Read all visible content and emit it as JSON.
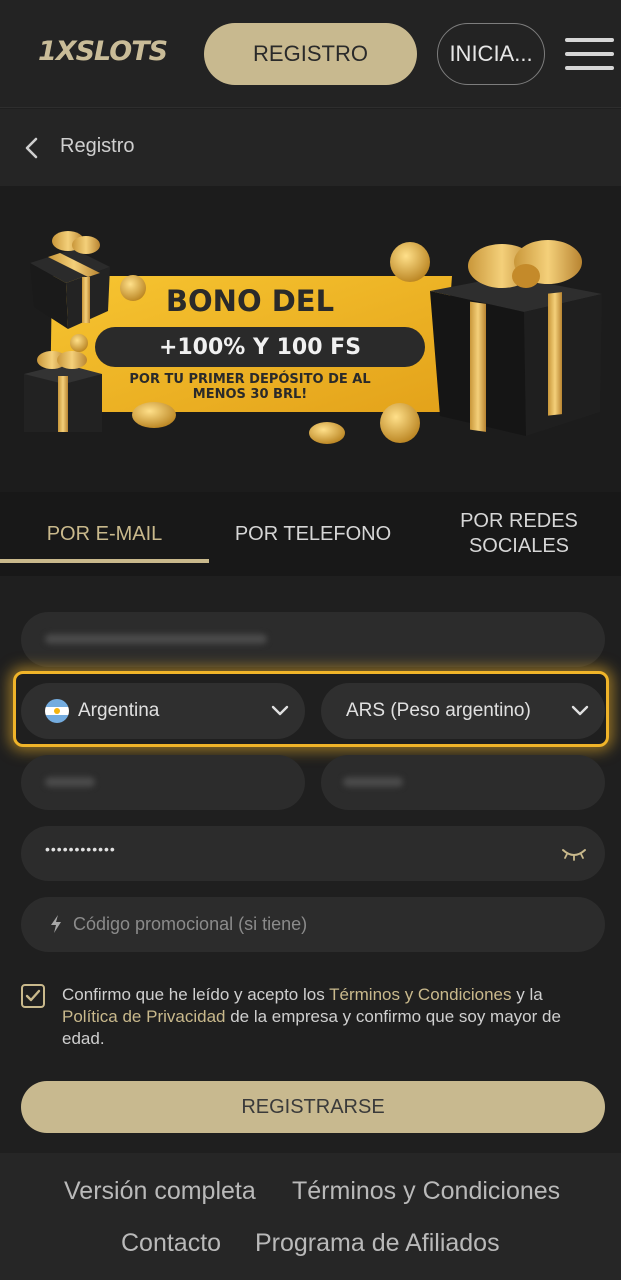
{
  "header": {
    "logo": "1XSLOTS",
    "register_label": "REGISTRO",
    "login_label": "INICIA..."
  },
  "subheader": {
    "title": "Registro"
  },
  "banner": {
    "title": "BONO DEL",
    "amount": "+100% Y 100 FS",
    "subtitle_line1": "POR TU PRIMER DEPÓSITO DE AL",
    "subtitle_line2": "MENOS 30 BRL!"
  },
  "tabs": [
    {
      "label": "POR E-MAIL"
    },
    {
      "label": "POR TELEFONO"
    },
    {
      "label_line1": "POR REDES",
      "label_line2": "SOCIALES"
    }
  ],
  "form": {
    "country_value": "Argentina",
    "currency_value": "ARS (Peso argentino)",
    "password_mask": "••••••••••••",
    "promo_placeholder": "Código promocional (si tiene)",
    "consent_text_1": "Confirmo que he leído y acepto los ",
    "consent_link_terms": "Términos y Condiciones",
    "consent_text_2": " y la ",
    "consent_link_privacy": "Política de Privacidad",
    "consent_text_3": " de la empresa y confirmo que soy mayor de edad.",
    "submit_label": "REGISTRARSE"
  },
  "footer": {
    "full_version": "Versión completa",
    "terms": "Términos y Condiciones",
    "contact": "Contacto",
    "affiliates": "Programa de Afiliados"
  },
  "colors": {
    "accent": "#c8b98f",
    "highlight": "#f0b429",
    "background": "#1f1f1f"
  }
}
